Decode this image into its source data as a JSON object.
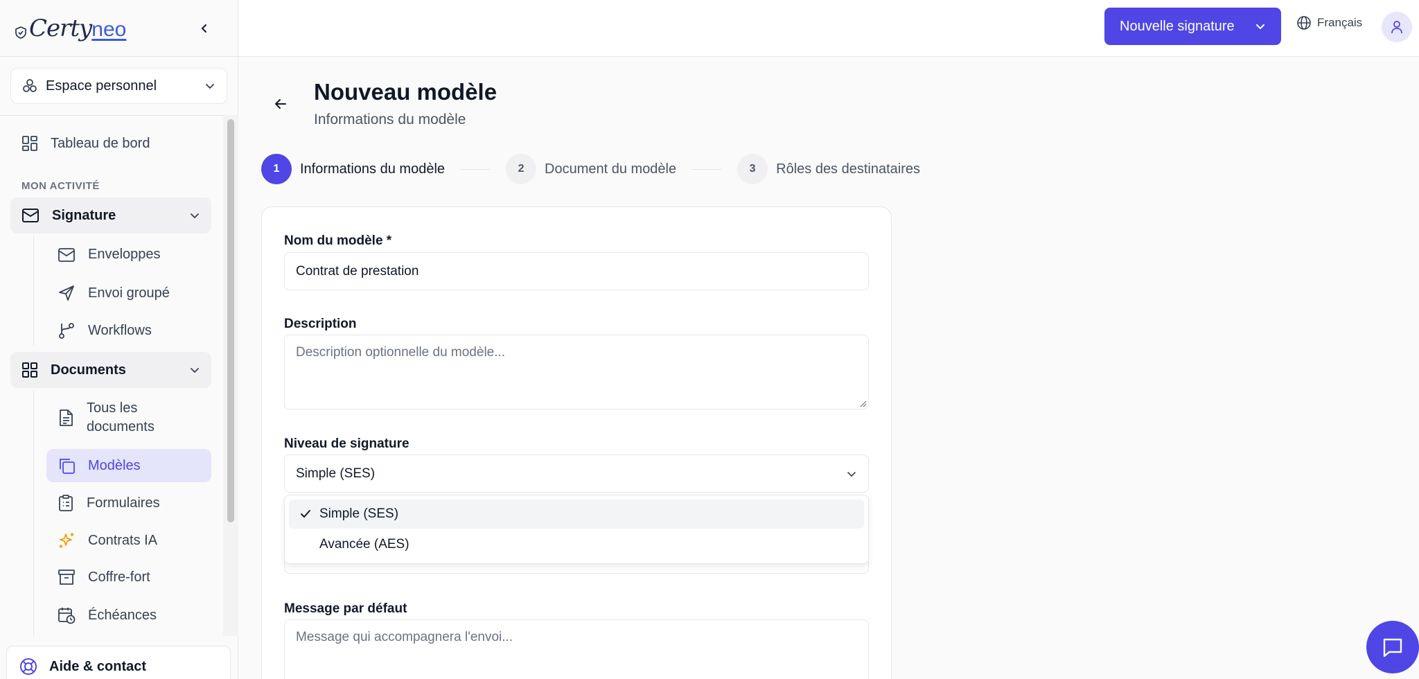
{
  "brand": {
    "logo_main": "Certy",
    "logo_suffix": "neo"
  },
  "workspace": {
    "label": "Espace personnel"
  },
  "sidebar": {
    "dashboard": "Tableau de bord",
    "section_activity": "MON ACTIVITÉ",
    "signature_group": "Signature",
    "signature_items": [
      "Enveloppes",
      "Envoi groupé",
      "Workflows"
    ],
    "documents_group": "Documents",
    "documents_items": [
      "Tous les documents",
      "Modèles",
      "Formulaires",
      "Contrats IA",
      "Coffre-fort",
      "Échéances"
    ],
    "help": "Aide & contact"
  },
  "topbar": {
    "new_signature": "Nouvelle signature",
    "language": "Français"
  },
  "page": {
    "title": "Nouveau modèle",
    "subtitle": "Informations du modèle"
  },
  "steps": [
    {
      "num": "1",
      "label": "Informations du modèle"
    },
    {
      "num": "2",
      "label": "Document du modèle"
    },
    {
      "num": "3",
      "label": "Rôles des destinataires"
    }
  ],
  "form": {
    "name_label": "Nom du modèle *",
    "name_value": "Contrat de prestation",
    "desc_label": "Description",
    "desc_placeholder": "Description optionnelle du modèle...",
    "level_label": "Niveau de signature",
    "level_value": "Simple (SES)",
    "level_options": [
      "Simple (SES)",
      "Avancée (AES)"
    ],
    "message_label": "Message par défaut",
    "message_placeholder": "Message qui accompagnera l'envoi..."
  },
  "colors": {
    "accent": "#4f46e5",
    "active_bg": "#e4e4fb",
    "icon_orange": "#f59e0b"
  }
}
